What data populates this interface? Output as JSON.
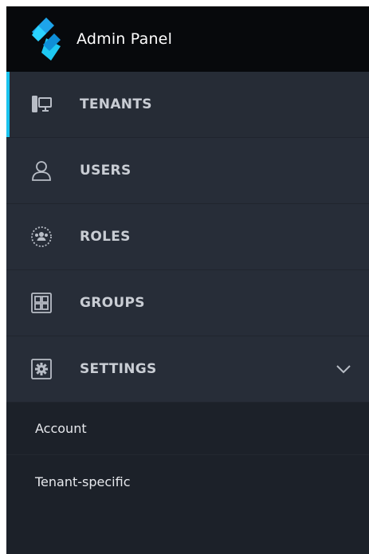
{
  "brand": {
    "title": "Admin Panel",
    "logo_icon": "layered-s-logo-icon",
    "accent": "#19c3ee"
  },
  "nav": {
    "items": [
      {
        "label": "TENANTS",
        "icon": "desktop-monitor-icon",
        "active": true
      },
      {
        "label": "USERS",
        "icon": "user-icon",
        "active": false
      },
      {
        "label": "ROLES",
        "icon": "people-circle-icon",
        "active": false
      },
      {
        "label": "GROUPS",
        "icon": "grid-icon",
        "active": false
      },
      {
        "label": "SETTINGS",
        "icon": "gear-box-icon",
        "active": false,
        "expanded": true,
        "chevron_icon": "chevron-down-icon"
      }
    ]
  },
  "submenu": {
    "items": [
      {
        "label": "Account"
      },
      {
        "label": "Tenant-specific"
      }
    ]
  },
  "colors": {
    "header_bg": "#07090c",
    "nav_bg": "#272d38",
    "submenu_bg": "#1c2129",
    "nav_text": "#c9cdd4",
    "icon_stroke": "#b8bdc6",
    "active_indicator": "#19c3ee"
  }
}
